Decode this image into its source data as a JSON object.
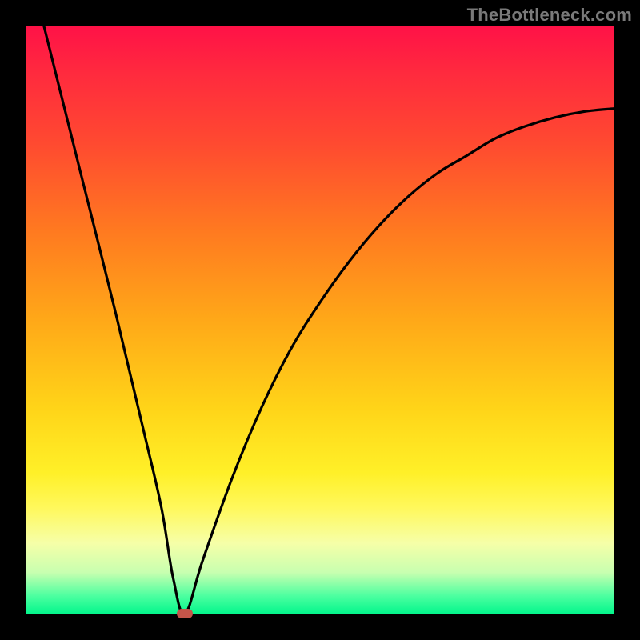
{
  "watermark": "TheBottleneck.com",
  "chart_data": {
    "type": "line",
    "title": "",
    "xlabel": "",
    "ylabel": "",
    "xlim": [
      0,
      100
    ],
    "ylim": [
      0,
      100
    ],
    "grid": false,
    "legend": false,
    "background": "vertical gradient red→orange→yellow→green",
    "series": [
      {
        "name": "bottleneck-curve",
        "x": [
          3,
          5,
          10,
          15,
          20,
          23,
          25,
          27,
          30,
          35,
          40,
          45,
          50,
          55,
          60,
          65,
          70,
          75,
          80,
          85,
          90,
          95,
          100
        ],
        "values": [
          100,
          92,
          72,
          52,
          31,
          18,
          6,
          0,
          9,
          23,
          35,
          45,
          53,
          60,
          66,
          71,
          75,
          78,
          81,
          83,
          84.5,
          85.5,
          86
        ]
      }
    ],
    "marker": {
      "x": 27,
      "y": 0,
      "color": "#c4554a"
    }
  },
  "colors": {
    "frame": "#000000",
    "curve": "#000000",
    "marker": "#c4554a",
    "watermark": "#7a7a7a"
  }
}
